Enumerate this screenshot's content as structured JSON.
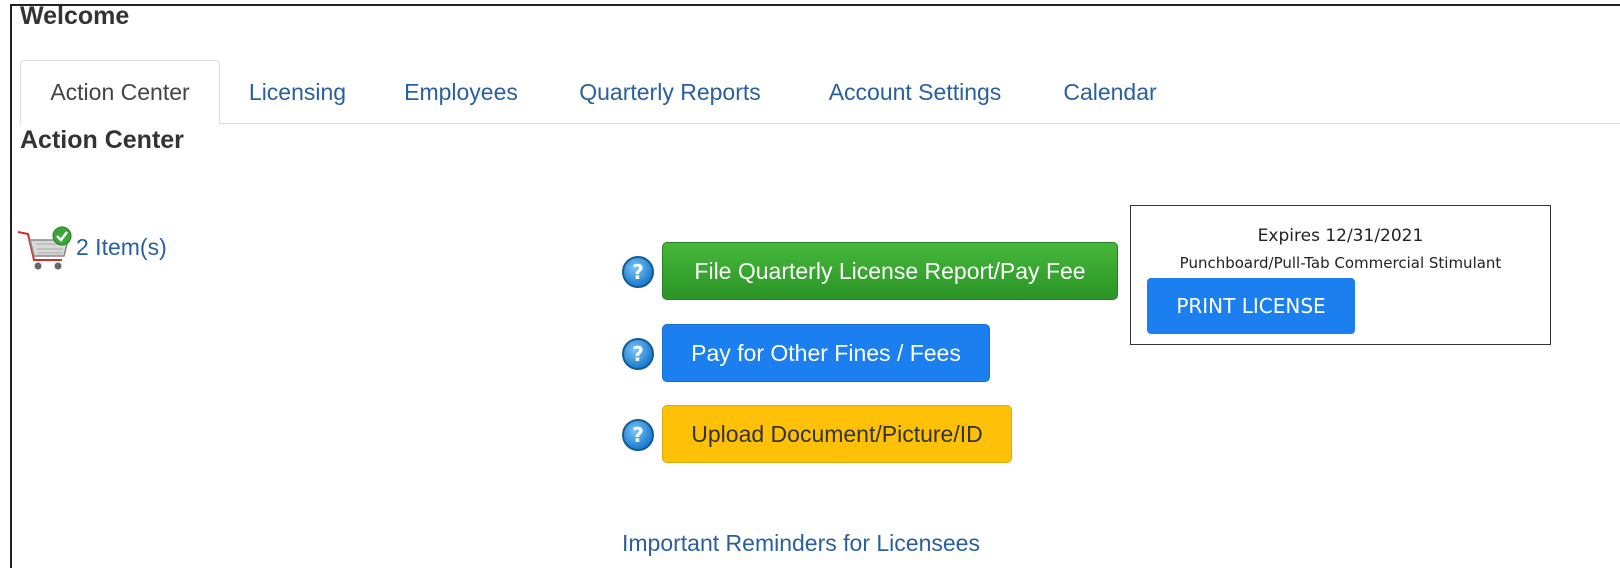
{
  "header": {
    "welcome": "Welcome"
  },
  "tabs": [
    {
      "label": "Action Center"
    },
    {
      "label": "Licensing"
    },
    {
      "label": "Employees"
    },
    {
      "label": "Quarterly Reports"
    },
    {
      "label": "Account Settings"
    },
    {
      "label": "Calendar"
    }
  ],
  "main": {
    "title": "Action Center",
    "cart": {
      "icon": "shopping-cart-icon",
      "label": "2 Item(s)"
    },
    "actions": {
      "file_quarterly": "File Quarterly License Report/Pay Fee",
      "pay_other": "Pay for Other Fines / Fees",
      "upload": "Upload Document/Picture/ID"
    },
    "help_icon": "question-icon",
    "reminders_link": "Important Reminders for Licensees"
  },
  "license": {
    "expires": "Expires 12/31/2021",
    "type": "Punchboard/Pull-Tab Commercial Stimulant",
    "print_label": "PRINT LICENSE"
  },
  "colors": {
    "link": "#2a5f9e",
    "green": "#2b9426",
    "blue": "#1b7ff0",
    "yellow": "#ffc107"
  }
}
